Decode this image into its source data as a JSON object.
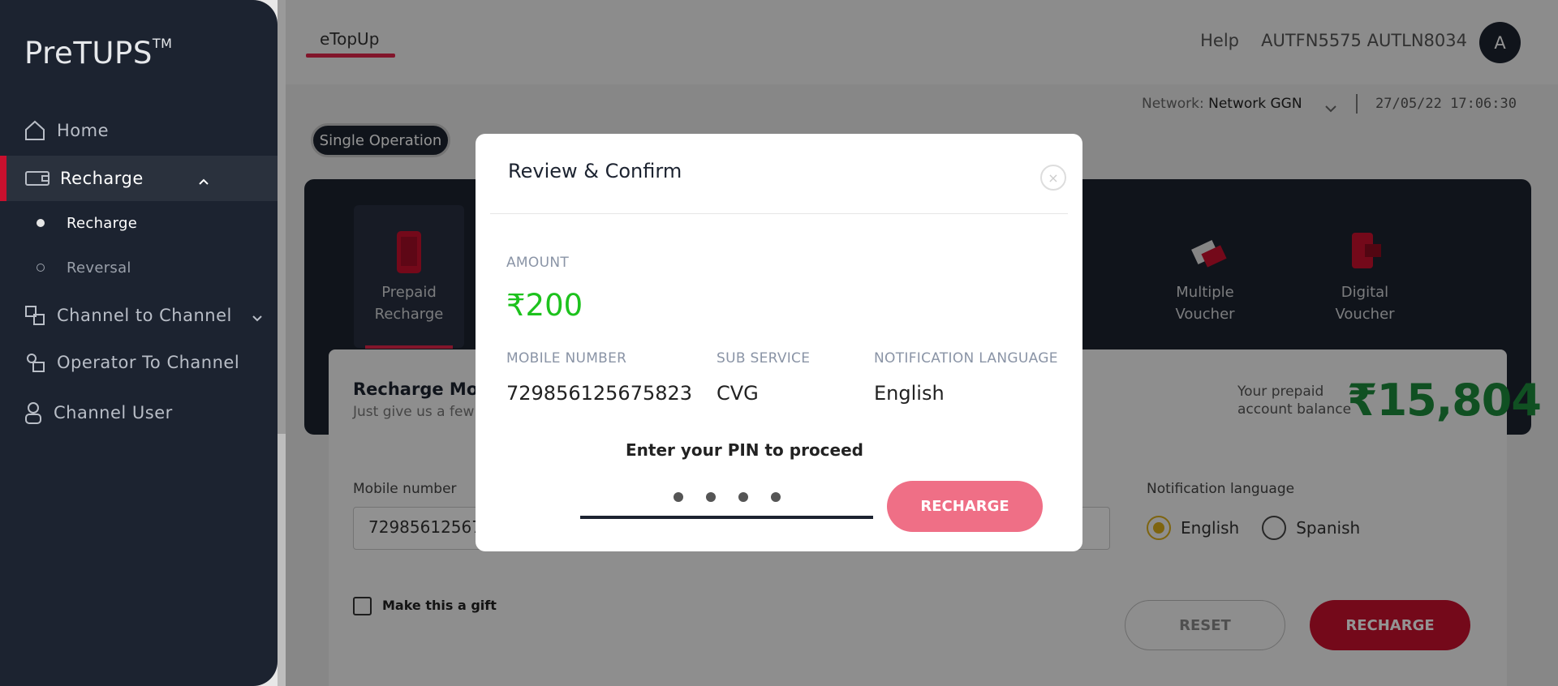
{
  "app": {
    "logo": "PreTUPS",
    "logo_tm": "TM"
  },
  "sidebar": {
    "items": [
      {
        "label": "Home",
        "icon": "home-icon"
      },
      {
        "label": "Recharge",
        "icon": "wallet-icon"
      },
      {
        "label": "Channel to Channel",
        "icon": "transfer-icon"
      },
      {
        "label": "Operator To Channel",
        "icon": "operator-icon"
      },
      {
        "label": "Channel User",
        "icon": "user-icon"
      }
    ],
    "sub_items": [
      {
        "label": "Recharge"
      },
      {
        "label": "Reversal"
      }
    ]
  },
  "header": {
    "tab": "eTopUp",
    "help": "Help",
    "username": "AUTFN5575 AUTLN8034",
    "avatar_initial": "A",
    "network_label": "Network:",
    "network_value": "Network GGN",
    "datetime": "27/05/22 17:06:30"
  },
  "operation_toggle": "Single Operation",
  "services": [
    {
      "label_line1": "Prepaid",
      "label_line2": "Recharge"
    },
    {
      "label_line1": "Multiple",
      "label_line2": "Voucher"
    },
    {
      "label_line1": "Digital",
      "label_line2": "Voucher"
    }
  ],
  "form": {
    "title": "Recharge Mob",
    "subtitle": "Just give us a few",
    "balance_label_line1": "Your prepaid",
    "balance_label_line2": "account balance",
    "balance_value": "₹15,804",
    "mobile_label": "Mobile number",
    "mobile_value": "72985612567",
    "notification_label": "Notification language",
    "lang_english": "English",
    "lang_spanish": "Spanish",
    "gift_label": "Make this a gift",
    "reset": "RESET",
    "recharge": "RECHARGE"
  },
  "modal": {
    "title": "Review & Confirm",
    "close": "×",
    "amount_label": "AMOUNT",
    "amount_value": "₹200",
    "mobile_label": "MOBILE NUMBER",
    "mobile_value": "729856125675823",
    "subservice_label": "SUB SERVICE",
    "subservice_value": "CVG",
    "notif_label": "NOTIFICATION LANGUAGE",
    "notif_value": "English",
    "pin_prompt": "Enter your PIN to proceed",
    "pin_length": 4,
    "button": "RECHARGE"
  },
  "colors": {
    "sidebar_bg": "#1c2330",
    "accent_red": "#c8102e",
    "amount_green": "#1dc21d",
    "balance_green": "#1d8a3c",
    "modal_button": "#ef6f86"
  }
}
